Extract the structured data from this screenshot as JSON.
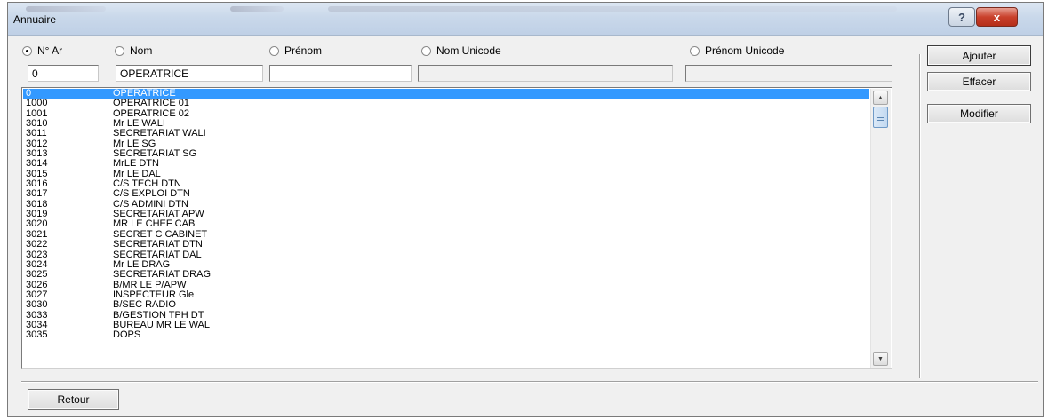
{
  "window": {
    "title": "Annuaire"
  },
  "titlebar": {
    "help_label": "?",
    "close_label": "x"
  },
  "search": {
    "radios": [
      {
        "label": "N° Ar",
        "checked": true
      },
      {
        "label": "Nom",
        "checked": false
      },
      {
        "label": "Prénom",
        "checked": false
      },
      {
        "label": "Nom Unicode",
        "checked": false
      },
      {
        "label": "Prénom Unicode",
        "checked": false
      }
    ],
    "fields": {
      "numero": "0",
      "nom": "OPERATRICE",
      "prenom": "",
      "nom_unicode": "",
      "prenom_unicode": ""
    }
  },
  "list": {
    "selected_index": 0,
    "rows": [
      {
        "num": "0",
        "name": "OPERATRICE"
      },
      {
        "num": "1000",
        "name": "OPERATRICE 01"
      },
      {
        "num": "1001",
        "name": "OPERATRICE 02"
      },
      {
        "num": "3010",
        "name": "Mr LE WALI"
      },
      {
        "num": "3011",
        "name": "SECRETARIAT WALI"
      },
      {
        "num": "3012",
        "name": "Mr LE SG"
      },
      {
        "num": "3013",
        "name": "SECRETARIAT SG"
      },
      {
        "num": "3014",
        "name": "MrLE DTN"
      },
      {
        "num": "3015",
        "name": "Mr LE DAL"
      },
      {
        "num": "3016",
        "name": "C/S TECH DTN"
      },
      {
        "num": "3017",
        "name": "C/S EXPLOI DTN"
      },
      {
        "num": "3018",
        "name": "C/S ADMINI DTN"
      },
      {
        "num": "3019",
        "name": "SECRETARIAT APW"
      },
      {
        "num": "3020",
        "name": "MR LE CHEF CAB"
      },
      {
        "num": "3021",
        "name": "SECRET C CABINET"
      },
      {
        "num": "3022",
        "name": "SECRETARIAT DTN"
      },
      {
        "num": "3023",
        "name": "SECRETARIAT DAL"
      },
      {
        "num": "3024",
        "name": "Mr LE DRAG"
      },
      {
        "num": "3025",
        "name": "SECRETARIAT DRAG"
      },
      {
        "num": "3026",
        "name": "B/MR LE P/APW"
      },
      {
        "num": "3027",
        "name": "INSPECTEUR Gle"
      },
      {
        "num": "3030",
        "name": "B/SEC RADIO"
      },
      {
        "num": "3033",
        "name": "B/GESTION TPH DT"
      },
      {
        "num": "3034",
        "name": "BUREAU MR LE WAL"
      },
      {
        "num": "3035",
        "name": "DOPS"
      }
    ]
  },
  "actions": {
    "ajouter": "Ajouter",
    "effacer": "Effacer",
    "modifier": "Modifier",
    "retour": "Retour"
  }
}
